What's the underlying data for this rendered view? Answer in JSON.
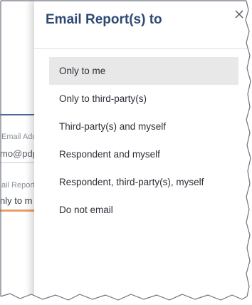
{
  "background_form": {
    "email_label": "Email Add",
    "email_value": "mo@pdp",
    "report_label": "ail Report",
    "report_value": "nly to m"
  },
  "panel": {
    "title": "Email Report(s) to",
    "close_icon": "close-icon"
  },
  "options": [
    {
      "label": "Only to me",
      "selected": true
    },
    {
      "label": "Only to third-party(s)",
      "selected": false
    },
    {
      "label": "Third-party(s) and myself",
      "selected": false
    },
    {
      "label": "Respondent and myself",
      "selected": false
    },
    {
      "label": "Respondent, third-party(s), myself",
      "selected": false
    },
    {
      "label": "Do not email",
      "selected": false
    }
  ],
  "colors": {
    "title": "#2f4a72",
    "selected_bg": "#e8e8e8",
    "accent_underline": "#e8a06a"
  }
}
